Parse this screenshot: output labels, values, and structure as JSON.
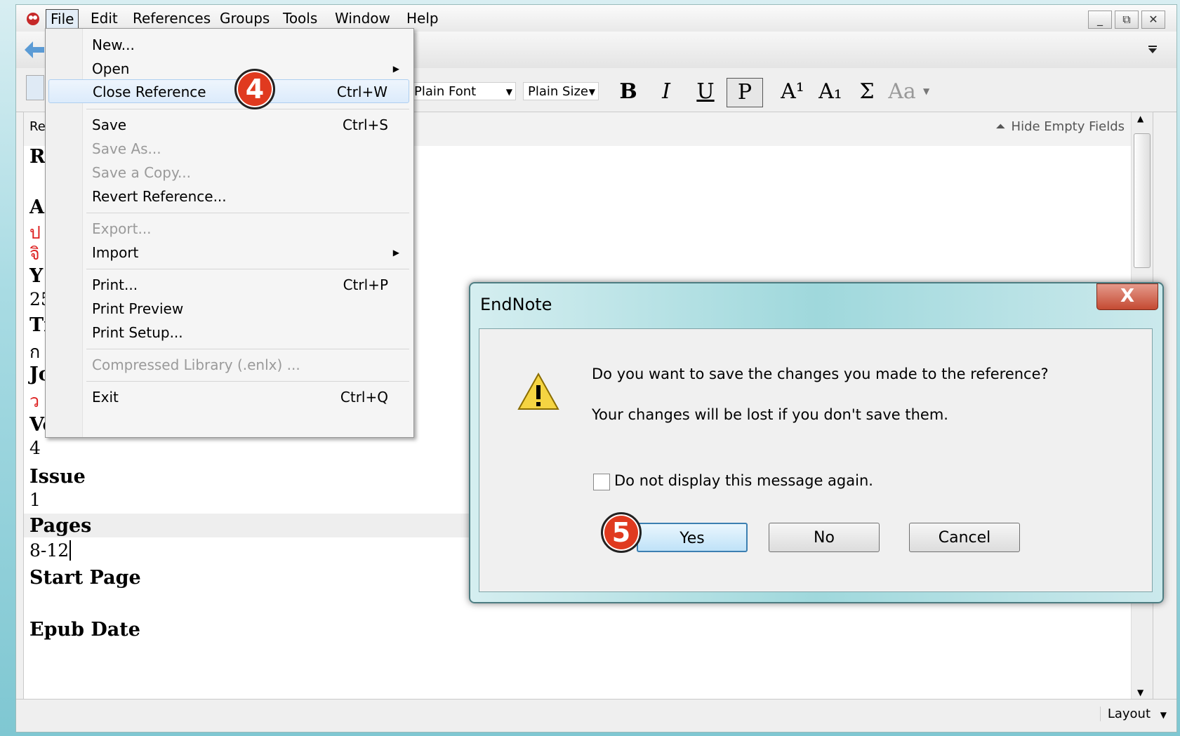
{
  "menubar": {
    "items": [
      "File",
      "Edit",
      "References",
      "Groups",
      "Tools",
      "Window",
      "Help"
    ],
    "window_buttons": [
      "_",
      "⧉",
      "✕"
    ]
  },
  "toolbar": {
    "font": "Plain Font",
    "size": "Plain Size",
    "bold": "B",
    "italic": "I",
    "underline": "U",
    "plain": "P",
    "superscript": "A¹",
    "subscript": "A₁",
    "symbol": "Σ",
    "case": "Aa"
  },
  "reference": {
    "header_label": "Re",
    "hide_empty": "Hide Empty Fields",
    "partial_rows": [
      {
        "text": "R",
        "kind": "label"
      },
      {
        "text": "A",
        "kind": "label"
      },
      {
        "text": "ป",
        "kind": "thai"
      },
      {
        "text": "จิ",
        "kind": "thai"
      },
      {
        "text": "Y",
        "kind": "label"
      },
      {
        "text": "25",
        "kind": "value"
      },
      {
        "text": "Ti",
        "kind": "label"
      },
      {
        "text": "ก",
        "kind": "value"
      },
      {
        "text": "Jo",
        "kind": "label"
      },
      {
        "text": "ว",
        "kind": "thai"
      }
    ],
    "fields": [
      {
        "label": "Volume",
        "value": "4"
      },
      {
        "label": "Issue",
        "value": "1"
      },
      {
        "label": "Pages",
        "value": "8-12"
      },
      {
        "label": "Start Page",
        "value": ""
      },
      {
        "label": "Epub Date",
        "value": ""
      }
    ]
  },
  "file_menu": {
    "items": [
      {
        "label": "New...",
        "shortcut": "",
        "submenu": false,
        "disabled": false
      },
      {
        "label": "Open",
        "shortcut": "",
        "submenu": true,
        "disabled": false
      },
      {
        "label": "Close Reference",
        "shortcut": "Ctrl+W",
        "submenu": false,
        "disabled": false,
        "highlighted": true
      },
      {
        "label": "Save",
        "shortcut": "Ctrl+S",
        "submenu": false,
        "disabled": false
      },
      {
        "label": "Save As...",
        "shortcut": "",
        "submenu": false,
        "disabled": true
      },
      {
        "label": "Save a Copy...",
        "shortcut": "",
        "submenu": false,
        "disabled": true
      },
      {
        "label": "Revert Reference...",
        "shortcut": "",
        "submenu": false,
        "disabled": false
      },
      {
        "label": "Export...",
        "shortcut": "",
        "submenu": false,
        "disabled": true
      },
      {
        "label": "Import",
        "shortcut": "",
        "submenu": true,
        "disabled": false
      },
      {
        "label": "Print...",
        "shortcut": "Ctrl+P",
        "submenu": false,
        "disabled": false
      },
      {
        "label": "Print Preview",
        "shortcut": "",
        "submenu": false,
        "disabled": false
      },
      {
        "label": "Print Setup...",
        "shortcut": "",
        "submenu": false,
        "disabled": false
      },
      {
        "label": "Compressed Library (.enlx) ...",
        "shortcut": "",
        "submenu": false,
        "disabled": true
      },
      {
        "label": "Exit",
        "shortcut": "Ctrl+Q",
        "submenu": false,
        "disabled": false
      }
    ]
  },
  "badges": {
    "step4": "4",
    "step5": "5"
  },
  "dialog": {
    "title": "EndNote",
    "close": "X",
    "message1": "Do you want to save the changes you made to the reference?",
    "message2": "Your changes will be lost if you don't save them.",
    "checkbox_label": "Do not display this message again.",
    "checkbox_checked": false,
    "yes": "Yes",
    "no": "No",
    "cancel": "Cancel"
  },
  "statusbar": {
    "layout": "Layout"
  },
  "colors": {
    "badge": "#e03a1f",
    "thai_text": "#d22222",
    "menu_highlight": "#dcebfb"
  }
}
